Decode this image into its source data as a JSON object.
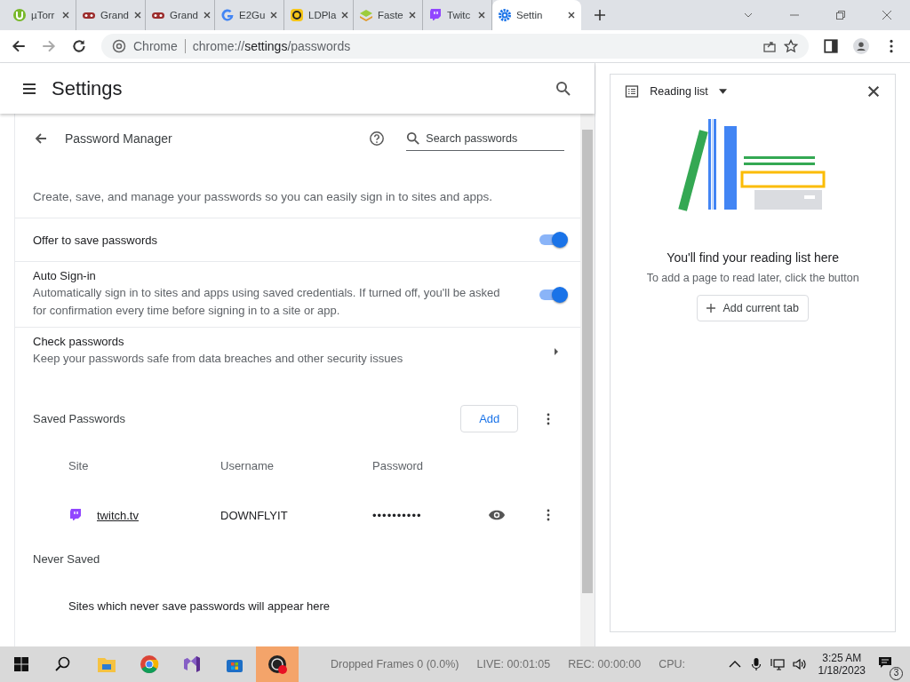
{
  "tabs": [
    {
      "label": "µTorr",
      "selected": false
    },
    {
      "label": "Grand",
      "selected": false
    },
    {
      "label": "Grand",
      "selected": false
    },
    {
      "label": "E2Gu",
      "selected": false
    },
    {
      "label": "LDPla",
      "selected": false
    },
    {
      "label": "Faste",
      "selected": false
    },
    {
      "label": "Twitc",
      "selected": false
    },
    {
      "label": "Settin",
      "selected": true
    }
  ],
  "address": {
    "site": "Chrome",
    "url_host": "chrome://",
    "url_bold": "settings",
    "url_path": "/passwords"
  },
  "settings": {
    "title": "Settings",
    "page_title": "Password Manager",
    "search": {
      "placeholder": "Search passwords"
    },
    "intro": "Create, save, and manage your passwords so you can easily sign in to sites and apps.",
    "options": [
      {
        "kind": "toggle",
        "title": "Offer to save passwords",
        "on": true
      },
      {
        "kind": "toggle",
        "title": "Auto Sign-in",
        "description": "Automatically sign in to sites and apps using saved credentials. If turned off, you'll be asked for confirmation every time before signing in to a site or app.",
        "on": true
      },
      {
        "kind": "link",
        "title": "Check passwords",
        "description": "Keep your passwords safe from data breaches and other security issues"
      }
    ],
    "saved": {
      "title": "Saved Passwords",
      "add_button": "Add",
      "columns": [
        "Site",
        "Username",
        "Password"
      ],
      "rows": [
        {
          "site": "twitch.tv",
          "username": "DOWNFLYIT",
          "password": "••••••••••"
        }
      ]
    },
    "never_saved": {
      "title": "Never Saved",
      "empty": "Sites which never save passwords will appear here"
    }
  },
  "reading_list": {
    "title": "Reading list",
    "heading": "You'll find your reading list here",
    "text": "To add a page to read later, click the button",
    "button": "Add current tab"
  },
  "taskbar": {
    "apps": [
      {
        "selected": false
      },
      {
        "selected": false
      },
      {
        "selected": false
      },
      {
        "selected": false
      },
      {
        "selected": true
      }
    ],
    "overlay": [
      "Dropped Frames 0 (0.0%)",
      "LIVE: 00:01:05",
      "REC: 00:00:00",
      "CPU:"
    ],
    "time": "3:25 AM",
    "date": "1/18/2023",
    "notifications": "3"
  }
}
